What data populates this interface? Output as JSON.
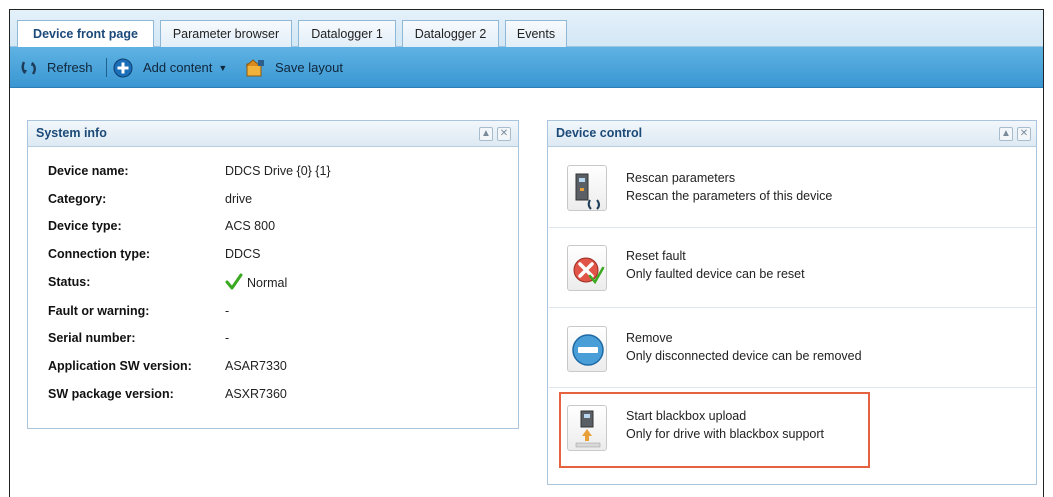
{
  "tabs": [
    {
      "label": "Device front page",
      "active": true
    },
    {
      "label": "Parameter browser",
      "active": false
    },
    {
      "label": "Datalogger 1",
      "active": false
    },
    {
      "label": "Datalogger 2",
      "active": false
    },
    {
      "label": "Events",
      "active": false
    }
  ],
  "toolbar": {
    "refresh_label": "Refresh",
    "add_content_label": "Add content",
    "save_layout_label": "Save layout",
    "refresh_icon": "refresh-icon",
    "add_icon": "plus-circle-icon",
    "save_icon": "save-layout-icon"
  },
  "system_info": {
    "title": "System info",
    "rows": [
      {
        "label": "Device name:",
        "value": "DDCS Drive {0} {1}"
      },
      {
        "label": "Category:",
        "value": "drive"
      },
      {
        "label": "Device type:",
        "value": "ACS 800"
      },
      {
        "label": "Connection type:",
        "value": "DDCS"
      },
      {
        "label": "Status:",
        "value": "Normal"
      },
      {
        "label": "Fault or warning:",
        "value": "-"
      },
      {
        "label": "Serial number:",
        "value": "-"
      },
      {
        "label": "Application SW version:",
        "value": "ASAR7330"
      },
      {
        "label": "SW package version:",
        "value": "ASXR7360"
      }
    ]
  },
  "device_control": {
    "title": "Device control",
    "items": [
      {
        "title": "Rescan parameters",
        "desc": "Rescan the parameters of this device",
        "icon": "rescan-icon"
      },
      {
        "title": "Reset fault",
        "desc": "Only faulted device can be reset",
        "icon": "reset-fault-icon"
      },
      {
        "title": "Remove",
        "desc": "Only disconnected device can be removed",
        "icon": "remove-icon"
      },
      {
        "title": "Start blackbox upload",
        "desc": "Only for drive with blackbox support",
        "icon": "blackbox-upload-icon"
      }
    ]
  },
  "colors": {
    "toolbar": "#3a96d2",
    "panel_title": "#1c4a78",
    "highlight": "#e4623f",
    "status_ok": "#3aa820"
  }
}
